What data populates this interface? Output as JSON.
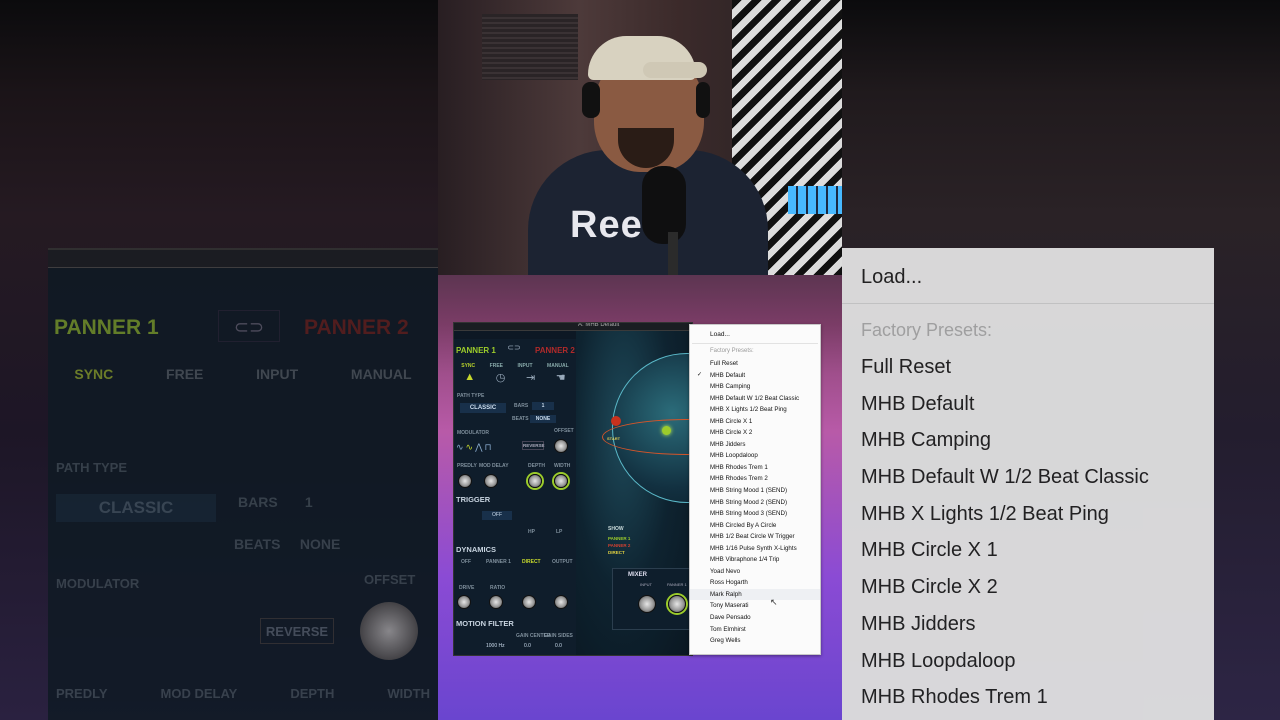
{
  "plugin": {
    "window_title": "A: MHB Default",
    "panner1_tab": "PANNER 1",
    "panner2_tab": "PANNER 2",
    "modes": [
      "SYNC",
      "FREE",
      "INPUT",
      "MANUAL"
    ],
    "path_type_label": "PATH TYPE",
    "path_type_value": "CLASSIC",
    "bars_label": "BARS",
    "bars_value": "1",
    "beats_label": "BEATS",
    "beats_value": "NONE",
    "modulator_label": "MODULATOR",
    "offset_label": "OFFSET",
    "reverse_label": "REVERSE",
    "predly_label": "PREDLY",
    "mod_delay_label": "MOD DELAY",
    "depth_label": "DEPTH",
    "width_label": "WIDTH",
    "trigger_label": "TRIGGER",
    "trigger_value": "OFF",
    "hp_label": "HP",
    "lp_label": "LP",
    "dynamics_label": "DYNAMICS",
    "dyn_modes": [
      "OFF",
      "PANNER 1",
      "DIRECT",
      "OUTPUT"
    ],
    "drive_label": "DRIVE",
    "ratio_label": "RATIO",
    "motion_filter_label": "MOTION FILTER",
    "gain_center_label": "GAIN CENTER",
    "gain_sides_label": "GAIN SIDES",
    "freq_value": "1000 Hz",
    "gain_center_value": "0.0",
    "gain_sides_value": "0.0",
    "start_label": "START",
    "show_label": "SHOW",
    "show_items": [
      "PANNER 1",
      "PANNER 2",
      "DIRECT"
    ],
    "mixer_label": "MIXER",
    "mixer_input": "INPUT",
    "mixer_panner1": "PANNER 1"
  },
  "menu": {
    "load_label": "Load...",
    "factory_header": "Factory Presets:",
    "checked_index": 1,
    "items": [
      "Full Reset",
      "MHB Default",
      "MHB Camping",
      "MHB Default W 1/2 Beat Classic",
      "MHB X Lights 1/2 Beat Ping",
      "MHB Circle X 1",
      "MHB Circle X 2",
      "MHB Jidders",
      "MHB Loopdaloop",
      "MHB Rhodes Trem 1",
      "MHB Rhodes Trem 2",
      "MHB String Mood 1 (SEND)",
      "MHB String Mood 2 (SEND)",
      "MHB String Mood 3 (SEND)",
      "MHB Circled By A Circle",
      "MHB 1/2 Beat Circle W Trigger",
      "MHB 1/16 Pulse Synth X-Lights",
      "MHB Vibraphone 1/4 Trip",
      "Yoad Nevo",
      "Ross Hogarth",
      "Mark Ralph",
      "Tony Maserati",
      "Dave Pensado",
      "Tom Elmhirst",
      "Greg Wells"
    ]
  },
  "zoom_menu": {
    "load_label": "Load...",
    "factory_header": "Factory Presets:",
    "items": [
      "Full Reset",
      "MHB Default",
      "MHB Camping",
      "MHB Default W 1/2 Beat Classic",
      "MHB X Lights 1/2 Beat Ping",
      "MHB Circle X 1",
      "MHB Circle X 2",
      "MHB Jidders",
      "MHB Loopdaloop",
      "MHB Rhodes Trem 1"
    ]
  },
  "zoom_plugin": {
    "panner1_tab": "PANNER 1",
    "panner2_tab": "PANNER 2",
    "modes": [
      "SYNC",
      "FREE",
      "INPUT",
      "MANUAL"
    ],
    "path_type_label": "PATH TYPE",
    "path_type_value": "CLASSIC",
    "bars_label": "BARS",
    "bars_value": "1",
    "beats_label": "BEATS",
    "beats_value": "NONE",
    "modulator_label": "MODULATOR",
    "offset_label": "OFFSET",
    "reverse_label": "REVERSE",
    "bottom_labels": [
      "PREDLY",
      "MOD DELAY",
      "DEPTH",
      "WIDTH"
    ]
  },
  "webcam": {
    "shirt_text": "Ree"
  },
  "colors": {
    "panner1_green": "#9ccc2b",
    "panner2_red": "#b02a2a",
    "video_purple": "#a04f8c"
  }
}
